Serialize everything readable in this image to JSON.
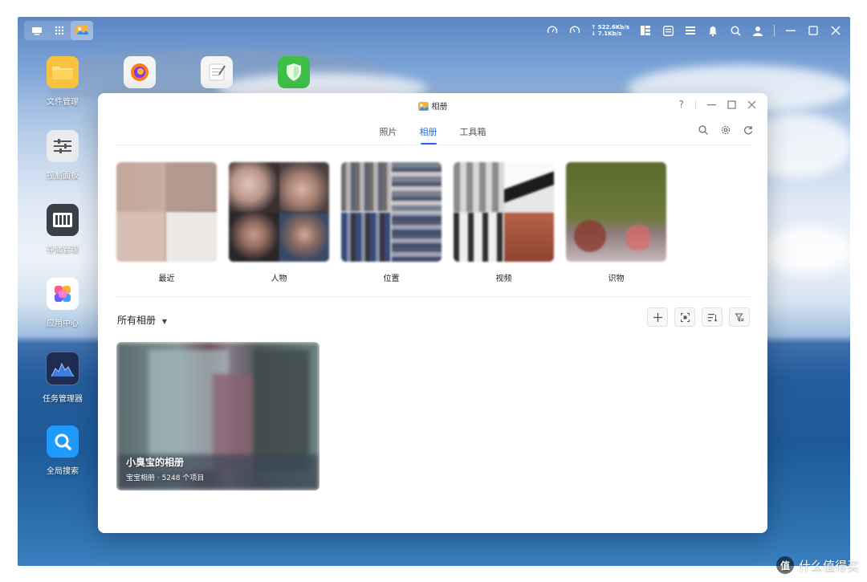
{
  "topbar": {
    "cpu_label": "CPU",
    "ram_label": "RAM",
    "upload_speed": "↑ 522.6Kb/s",
    "download_speed": "↓ 7.1Kb/s"
  },
  "desktop": {
    "icons": [
      {
        "label": "文件管理",
        "icon": "folder-icon"
      },
      {
        "label": "控制面板",
        "icon": "control-panel-icon"
      },
      {
        "label": "存储管理",
        "icon": "storage-icon"
      },
      {
        "label": "应用中心",
        "icon": "app-center-icon"
      },
      {
        "label": "任务管理器",
        "icon": "task-manager-icon"
      },
      {
        "label": "全局搜索",
        "icon": "search-app-icon"
      }
    ],
    "dock_apps": [
      "firefox-icon",
      "notes-icon",
      "security-shield-icon"
    ]
  },
  "window": {
    "title": "相册",
    "help": "?",
    "tabs": [
      {
        "label": "照片",
        "active": false
      },
      {
        "label": "相册",
        "active": true
      },
      {
        "label": "工具箱",
        "active": false
      }
    ],
    "categories": [
      {
        "label": "最近"
      },
      {
        "label": "人物"
      },
      {
        "label": "位置"
      },
      {
        "label": "视频"
      },
      {
        "label": "识物"
      }
    ],
    "all_albums_label": "所有相册",
    "album": {
      "name": "小臭宝的相册",
      "meta": "宝宝相册 · 5248 个项目"
    }
  },
  "watermark": {
    "logo_text": "值",
    "text": "什么值得买"
  },
  "colors": {
    "accent": "#2468e8"
  }
}
